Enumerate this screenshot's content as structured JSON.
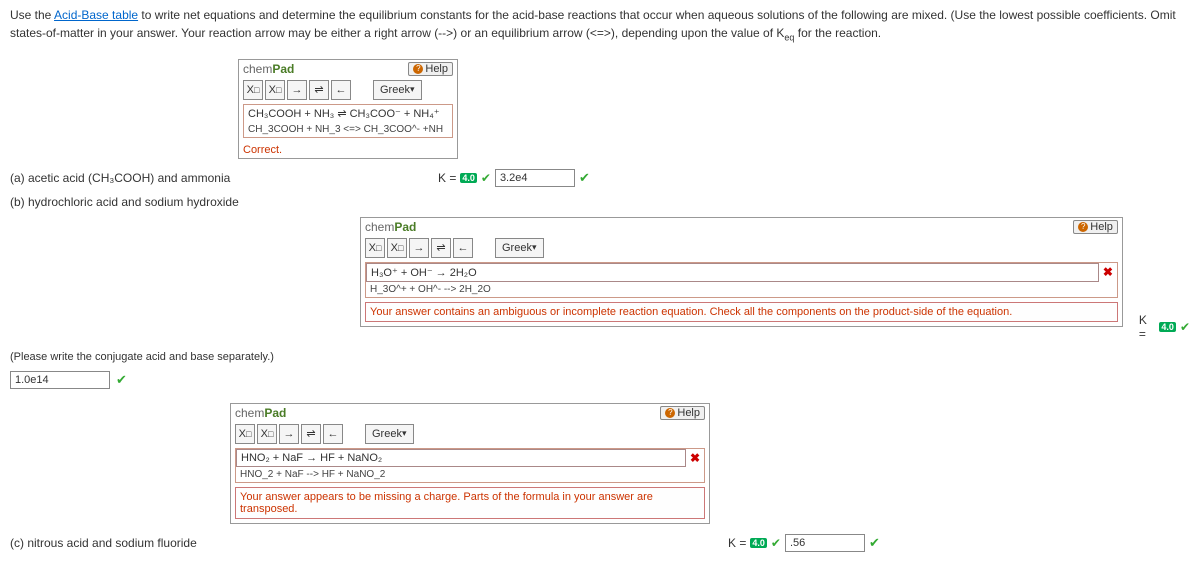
{
  "intro": {
    "pre": "Use the ",
    "link": "Acid-Base table",
    "post": " to write net equations and determine the equilibrium constants for the acid-base reactions that occur when aqueous solutions of the following are mixed. (Use the lowest possible coefficients. Omit states-of-matter in your answer. Your reaction arrow may be either a right arrow (-->) or an equilibrium arrow (<=>), depending upon the value of K",
    "sub": "eq",
    "tail": " for the reaction."
  },
  "chempad_title_a": "chem",
  "chempad_title_b": "Pad",
  "help_label": "Help",
  "greek_label": "Greek",
  "tb": {
    "xsub": "X",
    "xsup": "X",
    "rarrow": "→",
    "equil": "⇌",
    "larrow": "←"
  },
  "partA": {
    "label": "(a) acetic acid (CH₃COOH) and ammonia",
    "eq_render": "CH₃COOH + NH₃  ⇌  CH₃COO⁻  + NH₄⁺",
    "eq_raw": "CH_3COOH + NH_3 <=> CH_3COO^- +NH",
    "feedback": "Correct.",
    "k_label": "K =",
    "k_badge": "4.0",
    "k_value": "3.2e4"
  },
  "partB": {
    "label": "(b) hydrochloric acid and sodium hydroxide",
    "eq_render": "H₃O⁺ + OH⁻  →  2H₂O",
    "eq_raw": "H_3O^+ + OH^- --> 2H_2O",
    "feedback": "Your answer contains an ambiguous or incomplete reaction equation. Check all the components on the product-side of the equation.",
    "note": "(Please write the conjugate acid and base separately.)",
    "k_label": "K =",
    "k_badge": "4.0",
    "k_value": "1.0e14"
  },
  "partC": {
    "label": "(c) nitrous acid and sodium fluoride",
    "eq_render": "HNO₂ + NaF  →  HF + NaNO₂",
    "eq_raw": "HNO_2 + NaF --> HF + NaNO_2",
    "feedback": "Your answer appears to be missing a charge. Parts of the formula in your answer are transposed.",
    "k_label": "K =",
    "k_badge": "4.0",
    "k_value": ".56"
  }
}
